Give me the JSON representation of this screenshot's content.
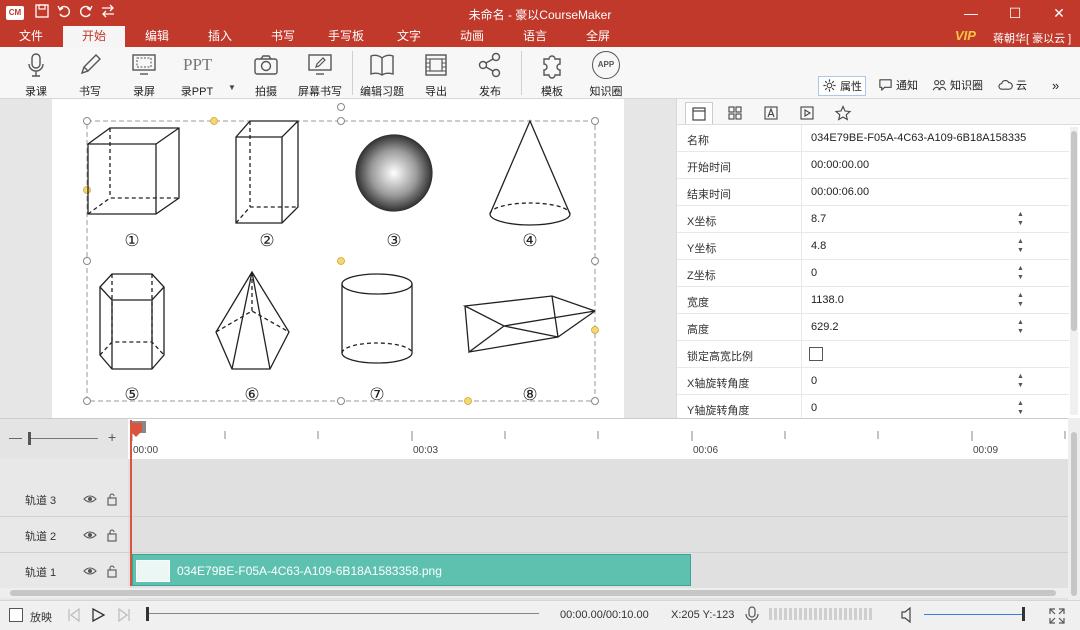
{
  "app": {
    "logo_text": "CM",
    "title": "未命名 - 豪以CourseMaker",
    "window_controls": {
      "minimize": "—",
      "maximize": "☐",
      "close": "✕"
    },
    "colors": {
      "brand": "#c0392b",
      "clip": "#5ec1b0",
      "playhead": "#d9533f",
      "vip": "#f5c542"
    }
  },
  "menu": {
    "items": [
      "文件",
      "开始",
      "编辑",
      "插入",
      "书写",
      "手写板",
      "文字",
      "动画",
      "语言",
      "全屏"
    ],
    "active": "开始",
    "vip_label": "VIP",
    "user_label": "蒋朝华[ 豪以云 ]"
  },
  "toolbar": {
    "record_course": "录课",
    "write": "书写",
    "record_screen": "录屏",
    "record_ppt": "录PPT",
    "ppt_icon_text": "PPT",
    "photo": "拍摄",
    "screen_write": "屏幕书写",
    "edit_exercise": "编辑习题",
    "export": "导出",
    "publish": "发布",
    "template": "模板",
    "knowledge": "知识圈",
    "app_icon_text": "APP",
    "right": {
      "properties": "属性",
      "notifications": "通知",
      "knowledge_circle": "知识圈",
      "cloud": "云"
    }
  },
  "canvas": {
    "labels": [
      "①",
      "②",
      "③",
      "④",
      "⑤",
      "⑥",
      "⑦",
      "⑧"
    ]
  },
  "properties": {
    "tab_icons": [
      "layout-icon",
      "grid-icon",
      "text-a-icon",
      "play-icon",
      "star-icon"
    ],
    "rows": [
      {
        "key": "名称",
        "value": "034E79BE-F05A-4C63-A109-6B18A158335",
        "spinner": false
      },
      {
        "key": "开始时间",
        "value": "00:00:00.00",
        "spinner": false
      },
      {
        "key": "结束时间",
        "value": "00:00:06.00",
        "spinner": false
      },
      {
        "key": "X坐标",
        "value": "8.7",
        "spinner": true
      },
      {
        "key": "Y坐标",
        "value": "4.8",
        "spinner": true
      },
      {
        "key": "Z坐标",
        "value": "0",
        "spinner": true
      },
      {
        "key": "宽度",
        "value": "1138.0",
        "spinner": true
      },
      {
        "key": "高度",
        "value": "629.2",
        "spinner": true
      },
      {
        "key": "锁定高宽比例",
        "value": "",
        "checkbox": true,
        "checked": false
      },
      {
        "key": "X轴旋转角度",
        "value": "0",
        "spinner": true
      },
      {
        "key": "Y轴旋转角度",
        "value": "0",
        "spinner": true
      }
    ]
  },
  "timeline": {
    "zoom_minus": "—",
    "zoom_plus": "+",
    "ruler_labels": [
      "00:00",
      "00:03",
      "00:06",
      "00:09"
    ],
    "tracks": [
      {
        "name": "轨道 3"
      },
      {
        "name": "轨道 2"
      },
      {
        "name": "轨道 1"
      }
    ],
    "clip_name": "034E79BE-F05A-4C63-A109-6B18A1583358.png"
  },
  "status": {
    "show_label": "放映",
    "time": "00:00.00/00:10.00",
    "coords": "X:205 Y:-123"
  }
}
